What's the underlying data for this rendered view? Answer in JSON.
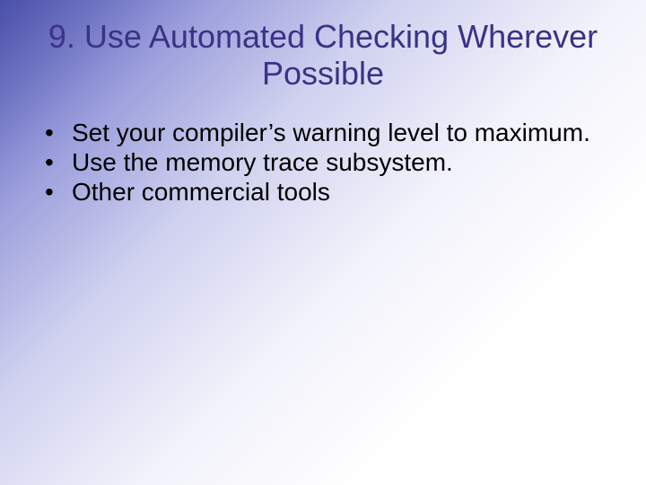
{
  "slide": {
    "title": "9. Use Automated Checking Wherever Possible",
    "bullets": [
      "Set your compiler’s warning level to maximum.",
      "Use the memory trace subsystem.",
      "Other commercial tools"
    ]
  }
}
